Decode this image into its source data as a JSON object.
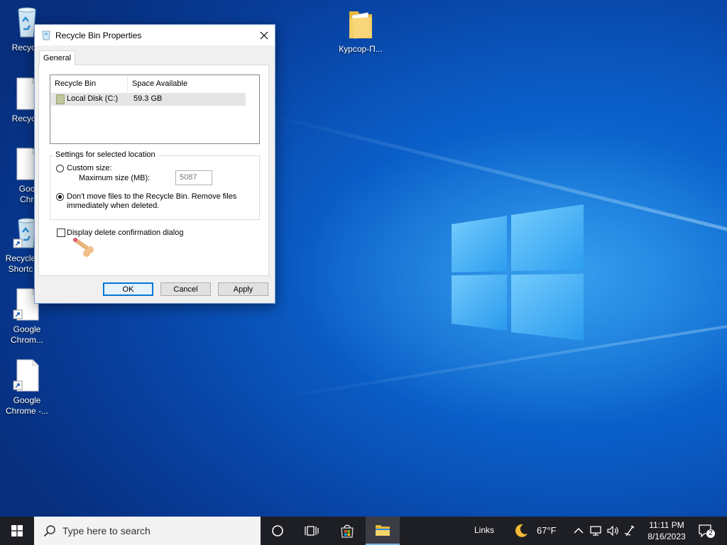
{
  "desktop": {
    "icons": [
      {
        "label": "Recycle"
      },
      {
        "label": "Recycle"
      },
      {
        "label": "Google Chrom"
      },
      {
        "label": "Recycle Shortc"
      },
      {
        "label": "Google Chrom..."
      },
      {
        "label": "Google Chrome -..."
      },
      {
        "label": "Курсор-П..."
      }
    ]
  },
  "dialog": {
    "title": "Recycle Bin Properties",
    "tab_label": "General",
    "list_headers": [
      "Recycle Bin Location",
      "Space Available"
    ],
    "list_rows": [
      {
        "location": "Local Disk (C:)",
        "space": "59.3 GB"
      }
    ],
    "settings_legend": "Settings for selected location",
    "custom_size_label": "Custom size:",
    "max_size_label": "Maximum size (MB):",
    "max_size_value": "5087",
    "dont_move_label_line1": "Don't move files to the Recycle Bin. Remove files",
    "dont_move_label_line2": "immediately when deleted.",
    "confirm_dialog_label": "Display delete confirmation dialog",
    "ok_label": "OK",
    "cancel_label": "Cancel",
    "apply_label": "Apply",
    "custom_size_selected": false,
    "dont_move_selected": true,
    "confirm_dialog_checked": false
  },
  "taskbar": {
    "search_placeholder": "Type here to search",
    "links_label": "Links",
    "temperature": "67°F",
    "time": "11:11 PM",
    "date": "8/16/2023",
    "notification_count": "2"
  },
  "colors": {
    "accent": "#0078d7",
    "taskbar_bg": "#1e1f25",
    "desktop_blue": "#0a5ec8"
  }
}
